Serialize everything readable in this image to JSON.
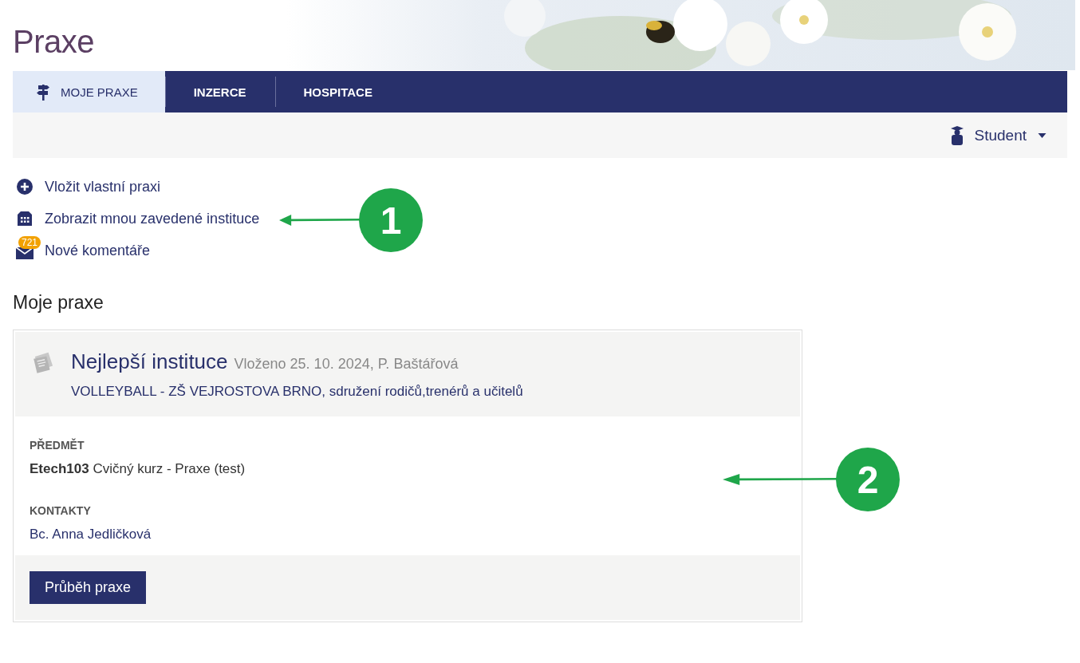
{
  "header": {
    "title": "Praxe",
    "kind": "picture"
  },
  "tabs": [
    {
      "label": "MOJE PRAXE",
      "selected": true,
      "kind": "signpost"
    },
    {
      "label": "INZERCE",
      "selected": false,
      "kind": "plain"
    },
    {
      "label": "HOSPITACE",
      "selected": false,
      "kind": "plain"
    }
  ],
  "role_menu": {
    "label": "Student"
  },
  "actions": [
    {
      "kind": "add",
      "label": "Vložit vlastní praxi"
    },
    {
      "kind": "institution",
      "label": "Zobrazit mnou zavedené instituce"
    },
    {
      "kind": "mail",
      "label": "Nové komentáře",
      "badge": "721"
    }
  ],
  "section_title": "Moje praxe",
  "practice": {
    "title": "Nejlepší instituce",
    "meta": "Vloženo 25. 10. 2024, P. Baštářová",
    "organization": "VOLLEYBALL - ZŠ VEJROSTOVA BRNO, sdružení rodičů,trenérů a učitelů",
    "fields": [
      {
        "label": "PŘEDMĚT",
        "value": "**Etech103** Cvičný kurz - Praxe (test)"
      },
      {
        "label": "KONTAKTY",
        "value": "Bc. Anna Jedličková"
      }
    ],
    "button": "Průběh praxe"
  },
  "callouts": [
    "1",
    "2"
  ]
}
